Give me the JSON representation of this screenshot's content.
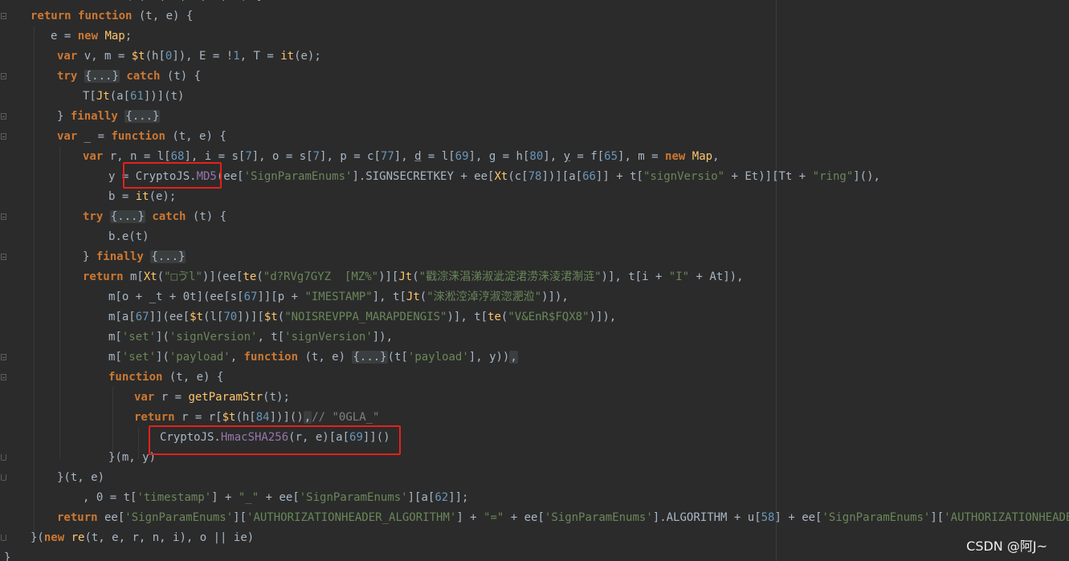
{
  "code_lines": [
    {
      "id": "l0",
      "tokens": [
        [
          "k",
          "var"
        ],
        [
          "p",
          " Ot = "
        ],
        [
          "k",
          "function"
        ],
        [
          "p",
          " (t, e, r, n, i, o) {"
        ]
      ]
    },
    {
      "id": "l1",
      "tokens": [
        [
          "k",
          "return"
        ],
        [
          "p",
          " "
        ],
        [
          "k",
          "function"
        ],
        [
          "p",
          " (t, e) {"
        ]
      ]
    },
    {
      "id": "l2",
      "tokens": [
        [
          "p",
          "e = "
        ],
        [
          "k",
          "new"
        ],
        [
          "p",
          " "
        ],
        [
          "f",
          "Map"
        ],
        [
          "p",
          ";"
        ]
      ]
    },
    {
      "id": "l3",
      "tokens": [
        [
          "k",
          "var"
        ],
        [
          "p",
          " v, m = "
        ],
        [
          "f",
          "$t"
        ],
        [
          "p",
          "(h["
        ],
        [
          "n",
          "0"
        ],
        [
          "p",
          "]), E = !"
        ],
        [
          "n",
          "1"
        ],
        [
          "p",
          ", T = "
        ],
        [
          "f",
          "it"
        ],
        [
          "p",
          "(e);"
        ]
      ]
    },
    {
      "id": "l4",
      "tokens": [
        [
          "k",
          "try"
        ],
        [
          "p",
          " "
        ],
        [
          "F",
          "{...}"
        ],
        [
          "p",
          " "
        ],
        [
          "k",
          "catch"
        ],
        [
          "p",
          " (t) {"
        ]
      ]
    },
    {
      "id": "l5",
      "tokens": [
        [
          "p",
          "T["
        ],
        [
          "f",
          "Jt"
        ],
        [
          "p",
          "(a["
        ],
        [
          "n",
          "61"
        ],
        [
          "p",
          "])](t)"
        ]
      ]
    },
    {
      "id": "l6",
      "tokens": [
        [
          "p",
          "} "
        ],
        [
          "k",
          "finally"
        ],
        [
          "p",
          " "
        ],
        [
          "F",
          "{...}"
        ]
      ]
    },
    {
      "id": "l7",
      "tokens": [
        [
          "k",
          "var"
        ],
        [
          "p",
          " _ = "
        ],
        [
          "k",
          "function"
        ],
        [
          "p",
          " (t, e) {"
        ]
      ]
    },
    {
      "id": "l8",
      "tokens": [
        [
          "k",
          "var"
        ],
        [
          "p",
          " r, n = l["
        ],
        [
          "n",
          "68"
        ],
        [
          "p",
          "], i = s["
        ],
        [
          "n",
          "7"
        ],
        [
          "p",
          "], o = s["
        ],
        [
          "n",
          "7"
        ],
        [
          "p",
          "], p = c["
        ],
        [
          "n",
          "77"
        ],
        [
          "p",
          "], "
        ],
        [
          "U",
          "d"
        ],
        [
          "p",
          " = l["
        ],
        [
          "n",
          "69"
        ],
        [
          "p",
          "], "
        ],
        [
          "U",
          "g"
        ],
        [
          "p",
          " = h["
        ],
        [
          "n",
          "80"
        ],
        [
          "p",
          "], "
        ],
        [
          "U",
          "y"
        ],
        [
          "p",
          " = f["
        ],
        [
          "n",
          "65"
        ],
        [
          "p",
          "], m = "
        ],
        [
          "k",
          "new"
        ],
        [
          "p",
          " "
        ],
        [
          "f",
          "Map"
        ],
        [
          "p",
          ","
        ]
      ]
    },
    {
      "id": "l9",
      "tokens": [
        [
          "p",
          "y = CryptoJS."
        ],
        [
          "P",
          "MD5"
        ],
        [
          "p",
          "(ee["
        ],
        [
          "s",
          "'SignParamEnums'"
        ],
        [
          "p",
          "].SIGNSECRETKEY + ee["
        ],
        [
          "f",
          "Xt"
        ],
        [
          "p",
          "(c["
        ],
        [
          "n",
          "78"
        ],
        [
          "p",
          "])][a["
        ],
        [
          "n",
          "66"
        ],
        [
          "p",
          "]] + t["
        ],
        [
          "s",
          "\"signVersio\""
        ],
        [
          "p",
          " + Et)][Tt + "
        ],
        [
          "s",
          "\"ring\""
        ],
        [
          "p",
          "](),"
        ]
      ]
    },
    {
      "id": "l10",
      "tokens": [
        [
          "p",
          "b = "
        ],
        [
          "f",
          "it"
        ],
        [
          "p",
          "(e);"
        ]
      ]
    },
    {
      "id": "l11",
      "tokens": [
        [
          "k",
          "try"
        ],
        [
          "p",
          " "
        ],
        [
          "F",
          "{...}"
        ],
        [
          "p",
          " "
        ],
        [
          "k",
          "catch"
        ],
        [
          "p",
          " (t) {"
        ]
      ]
    },
    {
      "id": "l12",
      "tokens": [
        [
          "p",
          "b.e(t)"
        ]
      ]
    },
    {
      "id": "l13",
      "tokens": [
        [
          "p",
          "} "
        ],
        [
          "k",
          "finally"
        ],
        [
          "p",
          " "
        ],
        [
          "F",
          "{...}"
        ]
      ]
    },
    {
      "id": "l14",
      "tokens": [
        [
          "k",
          "return"
        ],
        [
          "p",
          " m["
        ],
        [
          "f",
          "Xt"
        ],
        [
          "p",
          "("
        ],
        [
          "s",
          "\"□ゔl\""
        ],
        [
          "p",
          ")](ee["
        ],
        [
          "f",
          "te"
        ],
        [
          "p",
          "("
        ],
        [
          "s",
          "\"d?RVg7GYZ  [MZ%\""
        ],
        [
          "p",
          ")]["
        ],
        [
          "f",
          "Jt"
        ],
        [
          "p",
          "("
        ],
        [
          "s",
          "\"戳淙涞淐涕淑泚淀涒涝涞淩涒淛涟\""
        ],
        [
          "p",
          ")], t[i + "
        ],
        [
          "s",
          "\"I\""
        ],
        [
          "p",
          " + At]),"
        ]
      ]
    },
    {
      "id": "l15",
      "tokens": [
        [
          "p",
          "m[o + _t + 0t](ee[s["
        ],
        [
          "n",
          "67"
        ],
        [
          "p",
          "]][p + "
        ],
        [
          "s",
          "\"IMESTAMP\""
        ],
        [
          "p",
          "], t["
        ],
        [
          "f",
          "Jt"
        ],
        [
          "p",
          "("
        ],
        [
          "s",
          "\"淶淞涳淖涥淑淴淝涖\""
        ],
        [
          "p",
          ")]),"
        ]
      ]
    },
    {
      "id": "l16",
      "tokens": [
        [
          "p",
          "m[a["
        ],
        [
          "n",
          "67"
        ],
        [
          "p",
          "]](ee["
        ],
        [
          "f",
          "$t"
        ],
        [
          "p",
          "(l["
        ],
        [
          "n",
          "70"
        ],
        [
          "p",
          "])]["
        ],
        [
          "f",
          "$t"
        ],
        [
          "p",
          "("
        ],
        [
          "s",
          "\"NOISREVPPA_MARAPDENGIS\""
        ],
        [
          "p",
          ")], t["
        ],
        [
          "f",
          "te"
        ],
        [
          "p",
          "("
        ],
        [
          "s",
          "\"V&EnR$FQX8\""
        ],
        [
          "p",
          ")]),"
        ]
      ]
    },
    {
      "id": "l17",
      "tokens": [
        [
          "p",
          "m["
        ],
        [
          "s",
          "'set'"
        ],
        [
          "p",
          "]("
        ],
        [
          "s",
          "'signVersion'"
        ],
        [
          "p",
          ", t["
        ],
        [
          "s",
          "'signVersion'"
        ],
        [
          "p",
          "]),"
        ]
      ]
    },
    {
      "id": "l18",
      "tokens": [
        [
          "p",
          "m["
        ],
        [
          "s",
          "'set'"
        ],
        [
          "p",
          "]("
        ],
        [
          "s",
          "'payload'"
        ],
        [
          "p",
          ", "
        ],
        [
          "k",
          "function"
        ],
        [
          "p",
          " (t, e) "
        ],
        [
          "F",
          "{...}"
        ],
        [
          "p",
          "(t["
        ],
        [
          "s",
          "'payload'"
        ],
        [
          "p",
          "], y))"
        ],
        [
          "F",
          ","
        ]
      ]
    },
    {
      "id": "l19",
      "tokens": [
        [
          "k",
          "function"
        ],
        [
          "p",
          " (t, e) {"
        ]
      ]
    },
    {
      "id": "l20",
      "tokens": [
        [
          "k",
          "var"
        ],
        [
          "p",
          " r = "
        ],
        [
          "f",
          "getParamStr"
        ],
        [
          "p",
          "(t);"
        ]
      ]
    },
    {
      "id": "l21",
      "tokens": [
        [
          "k",
          "return"
        ],
        [
          "p",
          " r = r["
        ],
        [
          "f",
          "$t"
        ],
        [
          "p",
          "(h["
        ],
        [
          "n",
          "84"
        ],
        [
          "p",
          "])]()"
        ],
        [
          "F",
          ","
        ],
        [
          "c",
          "// \"0GLA_\""
        ]
      ]
    },
    {
      "id": "l22",
      "tokens": [
        [
          "p",
          "CryptoJS."
        ],
        [
          "P",
          "HmacSHA256"
        ],
        [
          "p",
          "(r, e)[a["
        ],
        [
          "n",
          "69"
        ],
        [
          "p",
          "]]()"
        ]
      ]
    },
    {
      "id": "l23",
      "tokens": [
        [
          "p",
          "}(m, y)"
        ]
      ]
    },
    {
      "id": "l24",
      "tokens": [
        [
          "p",
          "}(t, e)"
        ]
      ]
    },
    {
      "id": "l25",
      "tokens": [
        [
          "p",
          ", 0 = t["
        ],
        [
          "s",
          "'timestamp'"
        ],
        [
          "p",
          "] + "
        ],
        [
          "s",
          "\"_\""
        ],
        [
          "p",
          " + ee["
        ],
        [
          "s",
          "'SignParamEnums'"
        ],
        [
          "p",
          "][a["
        ],
        [
          "n",
          "62"
        ],
        [
          "p",
          "]];"
        ]
      ]
    },
    {
      "id": "l26",
      "tokens": [
        [
          "k",
          "return"
        ],
        [
          "p",
          " ee["
        ],
        [
          "s",
          "'SignParamEnums'"
        ],
        [
          "p",
          "]["
        ],
        [
          "s",
          "'AUTHORIZATIONHEADER_ALGORITHM'"
        ],
        [
          "p",
          "] + "
        ],
        [
          "s",
          "\"=\""
        ],
        [
          "p",
          " + ee["
        ],
        [
          "s",
          "'SignParamEnums'"
        ],
        [
          "p",
          "].ALGORITHM + u["
        ],
        [
          "n",
          "58"
        ],
        [
          "p",
          "] + ee["
        ],
        [
          "s",
          "'SignParamEnums'"
        ],
        [
          "p",
          "]["
        ],
        [
          "s",
          "'AUTHORIZATIONHEADER_SIGNE"
        ]
      ]
    },
    {
      "id": "l27",
      "tokens": [
        [
          "p",
          "}("
        ],
        [
          "k",
          "new"
        ],
        [
          "p",
          " "
        ],
        [
          "f",
          "re"
        ],
        [
          "p",
          "(t, e, r, n, i), o || ie)"
        ]
      ]
    },
    {
      "id": "l28",
      "tokens": [
        [
          "p",
          "}"
        ]
      ]
    }
  ],
  "watermark": "CSDN @阿J~"
}
